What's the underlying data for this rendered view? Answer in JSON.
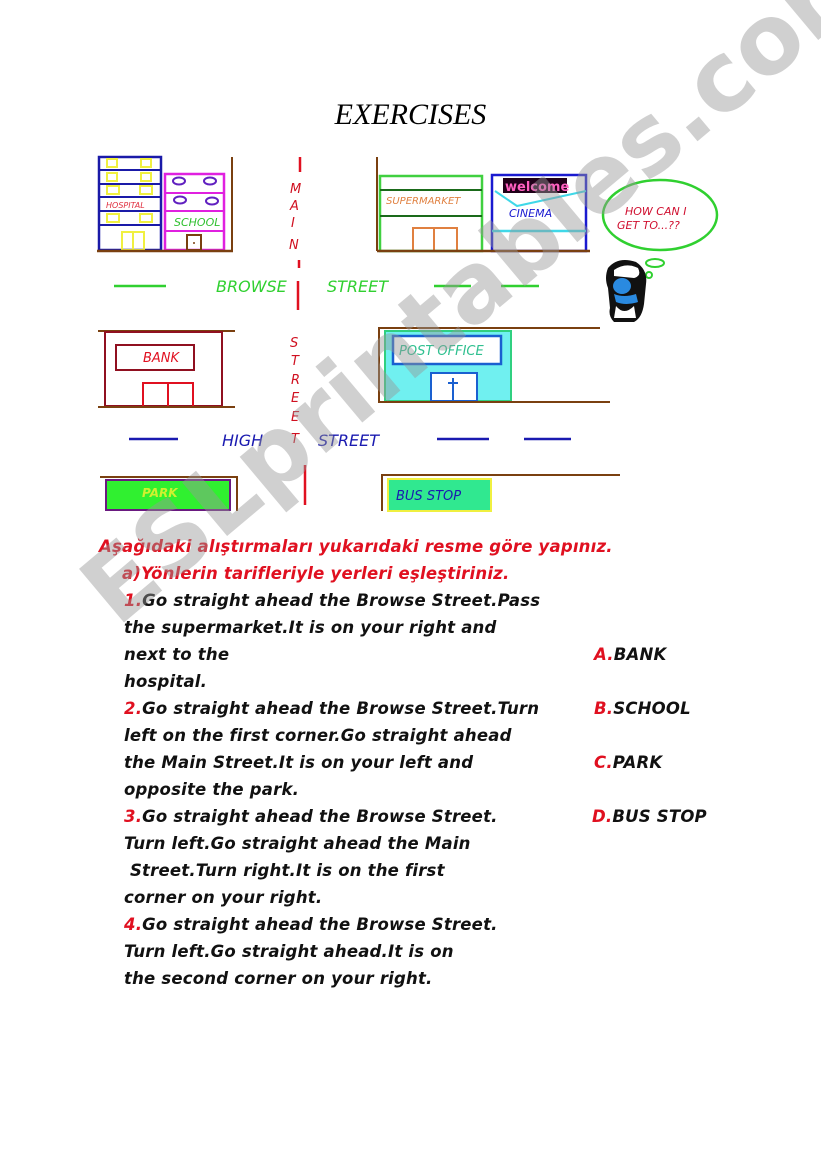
{
  "title": "EXERCISES",
  "map": {
    "buildings": {
      "hospital": "HOSPITAL",
      "school": "SCHOOL",
      "supermarket": "SUPERMARKET",
      "cinema_sign": "welcome",
      "cinema": "CINEMA",
      "bank": "BANK",
      "post_office": "POST OFFICE",
      "park": "PARK",
      "bus_stop": "BUS STOP"
    },
    "streets": {
      "main_letters": [
        "M",
        "A",
        "I",
        "N"
      ],
      "street_letters": [
        "S",
        "T",
        "R",
        "E",
        "E",
        "T"
      ],
      "browse_1": "BROWSE",
      "browse_2": "STREET",
      "high_1": "HIGH",
      "high_2": "STREET"
    },
    "speech_bubble": [
      "HOW CAN I",
      "GET TO...??"
    ]
  },
  "instructions": {
    "heading": "Aşağıdaki alıştırmaları yukarıdaki resme göre yapınız.",
    "subheading": "a)Yönlerin tarifleriyle yerleri eşleştiriniz."
  },
  "exercises": [
    {
      "number": "1",
      "lines": [
        "Go straight ahead the Browse Street.Pass",
        "the supermarket.It is on your right and",
        "next to the",
        "hospital."
      ]
    },
    {
      "number": "2",
      "lines": [
        "Go straight ahead the Browse Street.Turn",
        "left on the first corner.Go straight ahead",
        "the Main Street.It is on your left and",
        "opposite the park."
      ]
    },
    {
      "number": "3",
      "lines": [
        "Go straight ahead the Browse Street.",
        "Turn left.Go straight ahead the Main",
        " Street.Turn right.It is on the first",
        "corner on your right."
      ]
    },
    {
      "number": "4",
      "lines": [
        "Go straight ahead the Browse Street.",
        "Turn left.Go straight ahead.It is on",
        "the second corner on your right."
      ]
    }
  ],
  "answers": [
    {
      "letter": "A",
      "text": "BANK"
    },
    {
      "letter": "B",
      "text": "SCHOOL"
    },
    {
      "letter": "C",
      "text": "PARK"
    },
    {
      "letter": "D",
      "text": "BUS STOP"
    }
  ],
  "watermark": "ESLprintables.com"
}
